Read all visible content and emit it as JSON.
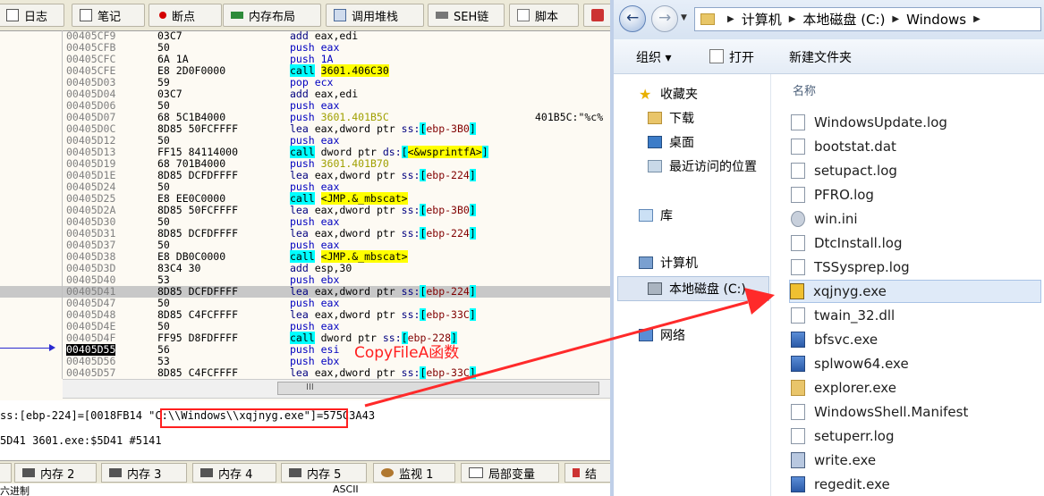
{
  "debugger": {
    "tabs": [
      {
        "label": "日志",
        "icon": "log-icon"
      },
      {
        "label": "笔记",
        "icon": "note-icon"
      },
      {
        "label": "断点",
        "icon": "breakpoint-icon"
      },
      {
        "label": "内存布局",
        "icon": "memory-map-icon"
      },
      {
        "label": "调用堆栈",
        "icon": "call-stack-icon"
      },
      {
        "label": "SEH链",
        "icon": "seh-chain-icon"
      },
      {
        "label": "脚本",
        "icon": "script-icon"
      }
    ],
    "rows": [
      {
        "addr": "00405CF9",
        "hex": "03C7",
        "asm": [
          [
            "m",
            "add "
          ],
          [
            "br",
            "eax,edi"
          ]
        ]
      },
      {
        "addr": "00405CFB",
        "hex": "50",
        "asm": [
          [
            "pu",
            "push "
          ],
          [
            "pu",
            "eax"
          ]
        ]
      },
      {
        "addr": "00405CFC",
        "hex": "6A 1A",
        "asm": [
          [
            "pu",
            "push "
          ],
          [
            "pu",
            "1A"
          ]
        ]
      },
      {
        "addr": "00405CFE",
        "hex": "E8 2D0F0000",
        "asm": [
          [
            "ca",
            "call"
          ],
          [
            "br",
            " "
          ],
          [
            "cy",
            "3601.406C30"
          ]
        ]
      },
      {
        "addr": "00405D03",
        "hex": "59",
        "asm": [
          [
            "pu",
            "pop "
          ],
          [
            "pu",
            "ecx"
          ]
        ]
      },
      {
        "addr": "00405D04",
        "hex": "03C7",
        "asm": [
          [
            "m",
            "add "
          ],
          [
            "br",
            "eax,edi"
          ]
        ]
      },
      {
        "addr": "00405D06",
        "hex": "50",
        "asm": [
          [
            "pu",
            "push "
          ],
          [
            "pu",
            "eax"
          ]
        ]
      },
      {
        "addr": "00405D07",
        "hex": "68 5C1B4000",
        "asm": [
          [
            "pu",
            "push "
          ],
          [
            "nm",
            "3601.401B5C"
          ]
        ],
        "comment": "401B5C:\"%c%"
      },
      {
        "addr": "00405D0C",
        "hex": "8D85 50FCFFFF",
        "asm": [
          [
            "m",
            "lea "
          ],
          [
            "br",
            "eax,dword ptr "
          ],
          [
            "m",
            "ss:"
          ],
          [
            "ss",
            "["
          ],
          [
            "rg",
            "ebp-3B0"
          ],
          [
            "ss",
            "]"
          ]
        ]
      },
      {
        "addr": "00405D12",
        "hex": "50",
        "asm": [
          [
            "pu",
            "push "
          ],
          [
            "pu",
            "eax"
          ]
        ]
      },
      {
        "addr": "00405D13",
        "hex": "FF15 84114000",
        "asm": [
          [
            "ca",
            "call"
          ],
          [
            "br",
            " dword ptr "
          ],
          [
            "m",
            "ds:"
          ],
          [
            "ss",
            "["
          ],
          [
            "cy",
            "<&wsprintfA>"
          ],
          [
            "ss",
            "]"
          ]
        ]
      },
      {
        "addr": "00405D19",
        "hex": "68 701B4000",
        "asm": [
          [
            "pu",
            "push "
          ],
          [
            "nm",
            "3601.401B70"
          ]
        ]
      },
      {
        "addr": "00405D1E",
        "hex": "8D85 DCFDFFFF",
        "asm": [
          [
            "m",
            "lea "
          ],
          [
            "br",
            "eax,dword ptr "
          ],
          [
            "m",
            "ss:"
          ],
          [
            "ss",
            "["
          ],
          [
            "rg",
            "ebp-224"
          ],
          [
            "ss",
            "]"
          ]
        ]
      },
      {
        "addr": "00405D24",
        "hex": "50",
        "asm": [
          [
            "pu",
            "push "
          ],
          [
            "pu",
            "eax"
          ]
        ]
      },
      {
        "addr": "00405D25",
        "hex": "E8 EE0C0000",
        "asm": [
          [
            "ca",
            "call"
          ],
          [
            "br",
            " "
          ],
          [
            "cy",
            "<JMP.&_mbscat>"
          ]
        ]
      },
      {
        "addr": "00405D2A",
        "hex": "8D85 50FCFFFF",
        "asm": [
          [
            "m",
            "lea "
          ],
          [
            "br",
            "eax,dword ptr "
          ],
          [
            "m",
            "ss:"
          ],
          [
            "ss",
            "["
          ],
          [
            "rg",
            "ebp-3B0"
          ],
          [
            "ss",
            "]"
          ]
        ]
      },
      {
        "addr": "00405D30",
        "hex": "50",
        "asm": [
          [
            "pu",
            "push "
          ],
          [
            "pu",
            "eax"
          ]
        ]
      },
      {
        "addr": "00405D31",
        "hex": "8D85 DCFDFFFF",
        "asm": [
          [
            "m",
            "lea "
          ],
          [
            "br",
            "eax,dword ptr "
          ],
          [
            "m",
            "ss:"
          ],
          [
            "ss",
            "["
          ],
          [
            "rg",
            "ebp-224"
          ],
          [
            "ss",
            "]"
          ]
        ]
      },
      {
        "addr": "00405D37",
        "hex": "50",
        "asm": [
          [
            "pu",
            "push "
          ],
          [
            "pu",
            "eax"
          ]
        ]
      },
      {
        "addr": "00405D38",
        "hex": "E8 DB0C0000",
        "asm": [
          [
            "ca",
            "call"
          ],
          [
            "br",
            " "
          ],
          [
            "cy",
            "<JMP.&_mbscat>"
          ]
        ]
      },
      {
        "addr": "00405D3D",
        "hex": "83C4 30",
        "asm": [
          [
            "m",
            "add "
          ],
          [
            "br",
            "esp,30"
          ]
        ]
      },
      {
        "addr": "00405D40",
        "hex": "53",
        "asm": [
          [
            "pu",
            "push "
          ],
          [
            "pu",
            "ebx"
          ]
        ]
      },
      {
        "addr": "00405D41",
        "hex": "8D85 DCFDFFFF",
        "asm": [
          [
            "m",
            "lea "
          ],
          [
            "br",
            "eax,dword ptr "
          ],
          [
            "m",
            "ss:"
          ],
          [
            "ss",
            "["
          ],
          [
            "rg",
            "ebp-224"
          ],
          [
            "ss",
            "]"
          ]
        ],
        "sel": true
      },
      {
        "addr": "00405D47",
        "hex": "50",
        "asm": [
          [
            "pu",
            "push "
          ],
          [
            "pu",
            "eax"
          ]
        ]
      },
      {
        "addr": "00405D48",
        "hex": "8D85 C4FCFFFF",
        "asm": [
          [
            "m",
            "lea "
          ],
          [
            "br",
            "eax,dword ptr "
          ],
          [
            "m",
            "ss:"
          ],
          [
            "ss",
            "["
          ],
          [
            "rg",
            "ebp-33C"
          ],
          [
            "ss",
            "]"
          ]
        ]
      },
      {
        "addr": "00405D4E",
        "hex": "50",
        "asm": [
          [
            "pu",
            "push "
          ],
          [
            "pu",
            "eax"
          ]
        ]
      },
      {
        "addr": "00405D4F",
        "hex": "FF95 D8FDFFFF",
        "asm": [
          [
            "ca",
            "call"
          ],
          [
            "br",
            " dword ptr "
          ],
          [
            "m",
            "ss:"
          ],
          [
            "ss",
            "["
          ],
          [
            "rg",
            "ebp-228"
          ],
          [
            "ss",
            "]"
          ]
        ]
      },
      {
        "addr": "00405D55",
        "hex": "56",
        "asm": [
          [
            "pu",
            "push "
          ],
          [
            "pu",
            "esi"
          ]
        ],
        "cur": true
      },
      {
        "addr": "00405D56",
        "hex": "53",
        "asm": [
          [
            "pu",
            "push "
          ],
          [
            "pu",
            "ebx"
          ]
        ]
      },
      {
        "addr": "00405D57",
        "hex": "8D85 C4FCFFFF",
        "asm": [
          [
            "m",
            "lea "
          ],
          [
            "br",
            "eax,dword ptr "
          ],
          [
            "m",
            "ss:"
          ],
          [
            "ss",
            "["
          ],
          [
            "rg",
            "ebp-33C"
          ],
          [
            "ss",
            "]"
          ]
        ]
      }
    ],
    "scroll_grip": "III",
    "annotation": "CopyFileA函数",
    "info_line1_prefix": "ss:[ebp-224]=[0018FB14 ",
    "info_line1_highlight": "\"C:\\\\Windows\\\\xqjnyg.exe\"",
    "info_line1_suffix": "]=575C3A43",
    "info_line2": "5D41 3601.exe:$5D41 #5141",
    "bottom_tabs": [
      {
        "label": "内存 2",
        "icon": "memory-icon"
      },
      {
        "label": "内存 3",
        "icon": "memory-icon"
      },
      {
        "label": "内存 4",
        "icon": "memory-icon"
      },
      {
        "label": "内存 5",
        "icon": "memory-icon"
      },
      {
        "label": "监视 1",
        "icon": "watch-icon"
      },
      {
        "label": "局部变量",
        "icon": "locals-icon"
      },
      {
        "label": "结",
        "icon": "struct-icon"
      }
    ],
    "status_left": "六进制",
    "status_ascii": "ASCII"
  },
  "explorer": {
    "breadcrumb": [
      "计算机",
      "本地磁盘 (C:)",
      "Windows"
    ],
    "toolbar": {
      "organize": "组织 ▾",
      "open": "打开",
      "new_folder": "新建文件夹"
    },
    "nav": {
      "favorites": "收藏夹",
      "downloads": "下载",
      "desktop": "桌面",
      "recent": "最近访问的位置",
      "libraries": "库",
      "computer": "计算机",
      "local_disk": "本地磁盘 (C:)",
      "network": "网络"
    },
    "column_header": "名称",
    "files": [
      {
        "name": "WindowsUpdate.log",
        "icon": "text-file-icon"
      },
      {
        "name": "bootstat.dat",
        "icon": "file-icon"
      },
      {
        "name": "setupact.log",
        "icon": "text-file-icon"
      },
      {
        "name": "PFRO.log",
        "icon": "text-file-icon"
      },
      {
        "name": "win.ini",
        "icon": "settings-file-icon"
      },
      {
        "name": "DtcInstall.log",
        "icon": "text-file-icon"
      },
      {
        "name": "TSSysprep.log",
        "icon": "text-file-icon"
      },
      {
        "name": "xqjnyg.exe",
        "icon": "malware-exe-icon",
        "selected": true
      },
      {
        "name": "twain_32.dll",
        "icon": "dll-file-icon"
      },
      {
        "name": "bfsvc.exe",
        "icon": "exe-icon"
      },
      {
        "name": "splwow64.exe",
        "icon": "exe-icon"
      },
      {
        "name": "explorer.exe",
        "icon": "folder-exe-icon"
      },
      {
        "name": "WindowsShell.Manifest",
        "icon": "file-icon"
      },
      {
        "name": "setuperr.log",
        "icon": "text-file-icon"
      },
      {
        "name": "write.exe",
        "icon": "write-exe-icon"
      },
      {
        "name": "regedit.exe",
        "icon": "regedit-exe-icon"
      }
    ]
  },
  "colors": {
    "annotation_red": "#ff2020",
    "selection_blue": "#dfeaf8"
  }
}
